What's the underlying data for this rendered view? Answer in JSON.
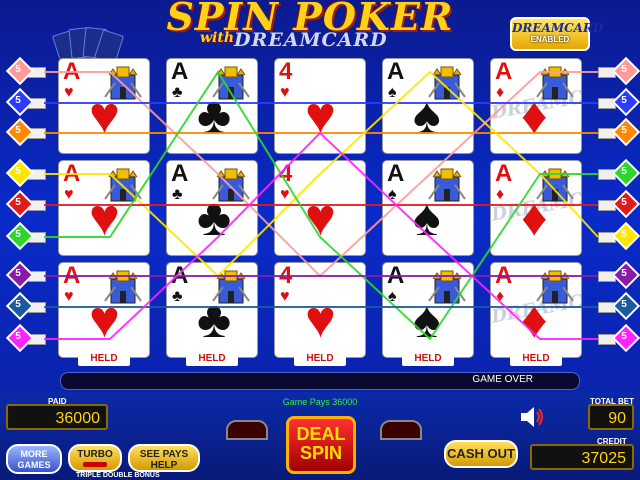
{
  "title": {
    "line1": "SPIN POKER",
    "with": "with",
    "dreamcard": "DREAMCARD"
  },
  "badge": {
    "line1": "DREAMCARD",
    "line2": "ENABLED"
  },
  "paylines": {
    "left": [
      {
        "num": "5",
        "color": "#ff9a9a"
      },
      {
        "num": "5",
        "color": "#2b3bff"
      },
      {
        "num": "5",
        "color": "#ff8800"
      },
      {
        "num": "5",
        "color": "#ffe600"
      },
      {
        "num": "5",
        "color": "#e01b1b"
      },
      {
        "num": "5",
        "color": "#2cd62c"
      },
      {
        "num": "5",
        "color": "#8a1aa8"
      },
      {
        "num": "5",
        "color": "#1a5b9e"
      },
      {
        "num": "5",
        "color": "#ff22ff"
      }
    ],
    "right": [
      {
        "num": "5",
        "color": "#ff9a9a"
      },
      {
        "num": "5",
        "color": "#2b3bff"
      },
      {
        "num": "5",
        "color": "#ff8800"
      },
      {
        "num": "5",
        "color": "#2cd62c"
      },
      {
        "num": "5",
        "color": "#e01b1b"
      },
      {
        "num": "5",
        "color": "#ffe600"
      },
      {
        "num": "5",
        "color": "#8a1aa8"
      },
      {
        "num": "5",
        "color": "#1a5b9e"
      },
      {
        "num": "5",
        "color": "#ff22ff"
      }
    ]
  },
  "columns": [
    {
      "held": "HELD",
      "cards": [
        {
          "rank": "A",
          "suit": "♥",
          "color": "#e01010",
          "castle": true
        },
        {
          "rank": "A",
          "suit": "♥",
          "color": "#e01010",
          "castle": true
        },
        {
          "rank": "A",
          "suit": "♥",
          "color": "#e01010",
          "castle": true
        }
      ]
    },
    {
      "held": "HELD",
      "cards": [
        {
          "rank": "A",
          "suit": "♣",
          "color": "#111111",
          "castle": true
        },
        {
          "rank": "A",
          "suit": "♣",
          "color": "#111111",
          "castle": true
        },
        {
          "rank": "A",
          "suit": "♣",
          "color": "#111111",
          "castle": true
        }
      ]
    },
    {
      "held": "HELD",
      "cards": [
        {
          "rank": "4",
          "suit": "♥",
          "color": "#e01010",
          "castle": false
        },
        {
          "rank": "4",
          "suit": "♥",
          "color": "#e01010",
          "castle": false
        },
        {
          "rank": "4",
          "suit": "♥",
          "color": "#e01010",
          "castle": false
        }
      ]
    },
    {
      "held": "HELD",
      "cards": [
        {
          "rank": "A",
          "suit": "♠",
          "color": "#111111",
          "castle": true
        },
        {
          "rank": "A",
          "suit": "♠",
          "color": "#111111",
          "castle": true
        },
        {
          "rank": "A",
          "suit": "♠",
          "color": "#111111",
          "castle": true
        }
      ]
    },
    {
      "held": "HELD",
      "cards": [
        {
          "rank": "A",
          "suit": "♦",
          "color": "#e01010",
          "castle": true,
          "dream": "DREAMCARD"
        },
        {
          "rank": "A",
          "suit": "♦",
          "color": "#e01010",
          "castle": true,
          "dream": "DREAMCARD"
        },
        {
          "rank": "A",
          "suit": "♦",
          "color": "#e01010",
          "castle": true,
          "dream": "DREAMCARD"
        }
      ]
    }
  ],
  "status": {
    "message": "GAME OVER"
  },
  "pays": "Game Pays 36000",
  "meters": {
    "paid_label": "PAID",
    "paid": "36000",
    "total_bet_label": "TOTAL BET",
    "total_bet": "90",
    "credit_label": "CREDIT",
    "credit": "37025"
  },
  "buttons": {
    "more_games": "MORE GAMES",
    "turbo": "TURBO",
    "see_pays": "SEE PAYS HELP",
    "deal_spin": "DEAL SPIN",
    "cash_out": "CASH OUT"
  },
  "footer": {
    "triple_double": "TRIPLE DOUBLE BONUS"
  },
  "icons": {
    "speaker": "speaker-icon",
    "castle": "castle-icon"
  }
}
